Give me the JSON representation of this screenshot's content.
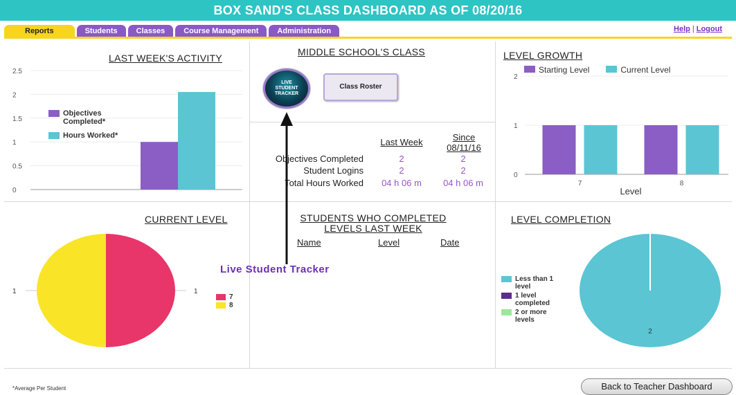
{
  "header": {
    "title": "BOX SAND'S CLASS DASHBOARD AS OF 08/20/16"
  },
  "tabs": [
    {
      "label": "Reports",
      "active": true
    },
    {
      "label": "Students"
    },
    {
      "label": "Classes"
    },
    {
      "label": "Course Management"
    },
    {
      "label": "Administration"
    }
  ],
  "links": {
    "help": "Help",
    "separator": "|",
    "logout": "Logout"
  },
  "panels": {
    "last_week_activity": "LAST WEEK'S ACTIVITY",
    "middle_school_class": "MIDDLE SCHOOL'S CLASS",
    "level_growth": "LEVEL GROWTH",
    "current_level": "CURRENT LEVEL",
    "students_completed_line1": "STUDENTS WHO COMPLETED",
    "students_completed_line2": "LEVELS LAST WEEK",
    "level_completion": "LEVEL COMPLETION"
  },
  "class_panel": {
    "tracker_button": "LIVE STUDENT TRACKER",
    "roster_button": "Class Roster",
    "col_last_week": "Last Week",
    "col_since_line1": "Since",
    "col_since_line2": "08/11/16",
    "rows": [
      {
        "label": "Objectives Completed",
        "last_week": "2",
        "since": "2"
      },
      {
        "label": "Student Logins",
        "last_week": "2",
        "since": "2"
      },
      {
        "label": "Total Hours Worked",
        "last_week": "04 h 06 m",
        "since": "04 h 06 m"
      }
    ]
  },
  "completed_table": {
    "headers": [
      "Name",
      "Level",
      "Date"
    ]
  },
  "annotation": "Live Student Tracker",
  "footer": {
    "footnote": "*Average Per Student",
    "back_button": "Back to Teacher Dashboard"
  },
  "colors": {
    "teal": "#2ec4c4",
    "purple": "#8a59c6",
    "yellow": "#f7d51e",
    "bar_teal": "#5bc5d4",
    "pink": "#e8356a"
  },
  "chart_data": [
    {
      "type": "bar",
      "title": "LAST WEEK'S ACTIVITY",
      "categories": [
        ""
      ],
      "series": [
        {
          "name": "Objectives Completed*",
          "values": [
            1
          ],
          "color": "#8a5ec4"
        },
        {
          "name": "Hours Worked*",
          "values": [
            2.05
          ],
          "color": "#5bc5d4"
        }
      ],
      "yticks": [
        "2.5",
        "2",
        "1.5",
        "1",
        "0.5",
        "0"
      ],
      "ylim": [
        0,
        2.5
      ],
      "legend": "left"
    },
    {
      "type": "bar",
      "title": "LEVEL GROWTH",
      "categories": [
        "7",
        "8"
      ],
      "series": [
        {
          "name": "Starting Level",
          "values": [
            1,
            1
          ],
          "color": "#8a5ec4"
        },
        {
          "name": "Current Level",
          "values": [
            1,
            1
          ],
          "color": "#5bc5d4"
        }
      ],
      "yticks": [
        "2",
        "1",
        "0"
      ],
      "ylim": [
        0,
        2
      ],
      "xlabel": "Level",
      "legend": "top"
    },
    {
      "type": "pie",
      "title": "CURRENT LEVEL",
      "slices": [
        {
          "label": "7",
          "value": 1,
          "color": "#e8356a"
        },
        {
          "label": "8",
          "value": 1,
          "color": "#f9e428"
        }
      ],
      "data_labels": [
        "1",
        "1"
      ]
    },
    {
      "type": "pie",
      "title": "LEVEL COMPLETION",
      "slices": [
        {
          "label": "Less than 1 level",
          "value": 2,
          "color": "#5bc5d4"
        },
        {
          "label": "1 level completed",
          "value": 0,
          "color": "#5b2c91"
        },
        {
          "label": "2 or more levels",
          "value": 0,
          "color": "#9be89b"
        }
      ],
      "data_labels": [
        "2"
      ]
    }
  ]
}
